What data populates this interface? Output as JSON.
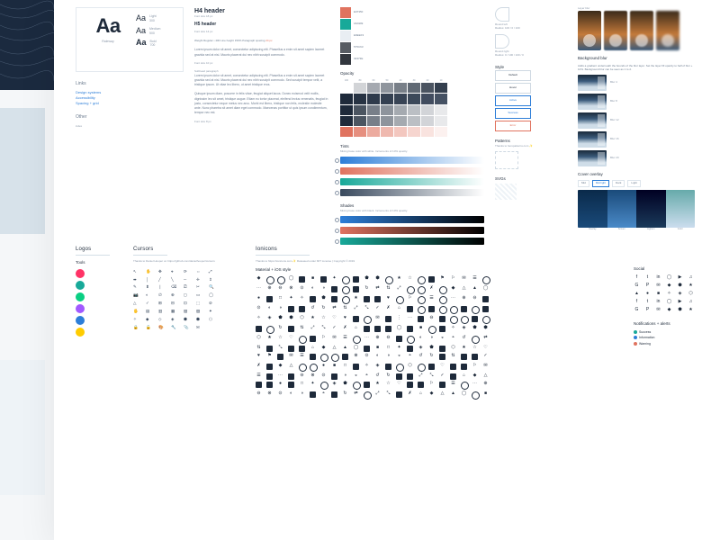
{
  "font": {
    "family": "Raleway",
    "sample": "Aa",
    "weights": [
      {
        "name": "Light",
        "w": "300"
      },
      {
        "name": "Medium",
        "w": "500"
      },
      {
        "name": "Bold",
        "w": "700"
      }
    ]
  },
  "links_header": "Links",
  "links": [
    "Design systems",
    "Accessibility",
    "Spacing + grid"
  ],
  "other_header": "Other",
  "other_links": [
    "index"
  ],
  "h4": "H4 header",
  "h4_meta": "Font size 18 px",
  "h5": "H5 header",
  "h5_meta": "Font size 14 px",
  "para_meta_prefix": "Weight Regular • 400    Line height 150%    Paragraph spacing ",
  "para_meta_em": "24 px",
  "p1": "Lorem ipsum dolor sit amet, consectetur adipiscing elit. Phasellus a enim sit amet sapien laoreet gravida sed at nisi. Mauris placerat dui nec nibh suscipit commodo.",
  "para_footer": "Font size 10 px",
  "subhead_para": "Subhead paragraph",
  "p2": "Lorem ipsum dolor sit amet, consectetur adipiscing elit. Phasellus a enim sit amet sapien laoreet gravida sed at nisi. Mauris placerat dui nec nibh suscipit commodo. Sed suscipit tempor velit, a tristique ipsum. Ut vitae leo libero, ut amet tristique eros.",
  "p3": "Quisque ipsum diam, posuere in felis vitae, feugiat aliquet lacus. Donec euismod velit mollis, dignissim leo sit amet, tristique augue. Etiam eu tortor placerat, eleifend lectus venenatis, feugiat in justo, consectetur neque metus nec arcu. Morbi est libero, tristique non felis, molestie molestie ante. Nunc pharetra sit amet diam eget commodo. Maecenas porttitor ut quis ipsum condimentum, tempor nec est.",
  "para2_footer": "Font size 8 px",
  "palette": [
    {
      "hex": "#E0735F",
      "label": "E0735F"
    },
    {
      "hex": "#18A999",
      "label": "18A999"
    },
    {
      "hex": "#E9EEF3",
      "label": "E9EEF3"
    },
    {
      "hex": "#575C63",
      "label": "575C63"
    },
    {
      "hex": "#32373E",
      "label": "32373E"
    }
  ],
  "opacity_header": "Opacity",
  "opacity_steps": [
    "100",
    "80",
    "60",
    "50",
    "40",
    "30",
    "20",
    "10"
  ],
  "opacity_cols": [
    "#FFFFFF",
    "#1E2A3A",
    "#1E2A3A",
    "#1E2A3A",
    "#E0735F"
  ],
  "bg_for_op": [
    "#1E2A3A",
    "#4a5668",
    "#FFFFFF",
    "#FFFFFF",
    "#FFFFFF"
  ],
  "tints_header": "Tints",
  "tints_note": "Mixing base color with white. Increments of 10% opacity.",
  "tint_colors": [
    "#2d7ed8",
    "#e0735f",
    "#18a999",
    "#3a4a5e"
  ],
  "shades_header": "Shades",
  "shades_note": "Mixing base color with black. Increments of 10% opacity.",
  "shade_colors": [
    "#2d7ed8",
    "#e0735f",
    "#18a999"
  ],
  "borders": {
    "round_left": {
      "label": "Round left",
      "radius": "Radius: 100 / 0 / 100"
    },
    "round_right": {
      "label": "Round right",
      "radius": "Radius: 0 / 100 / 100 / 0"
    }
  },
  "style_header": "Style",
  "styles": [
    {
      "name": "Default",
      "cls": ""
    },
    {
      "name": "Hover",
      "cls": ""
    },
    {
      "name": "Active",
      "cls": "active"
    },
    {
      "name": "Success",
      "cls": "active"
    },
    {
      "name": "Error",
      "cls": "error"
    }
  ],
  "patterns_header": "Patterns",
  "patterns_note": "Thanks to heropatterns.com ✨",
  "svgs_header": "SVGs",
  "layerblur_header": "Layer blur",
  "bgblur_header": "Background blur",
  "bgblur_note": "Adds a gradient underneath the bounds of the blur layer. Set the layer fill opacity to half of blur + 10%. Background blur can be seen as 1 to 2.",
  "bgblur_levels": [
    "Blur 4",
    "Blur 8",
    "Blur 12",
    "Blur 16",
    "Blur 20"
  ],
  "cover_header": "Cover overlay",
  "cover_tabs": [
    "Mid",
    "Mid light",
    "Dark",
    "Light"
  ],
  "cover_labels": [
    "Overlay",
    "Screen",
    "Lighten",
    "Color"
  ],
  "logos_header": "Logos",
  "tools_header": "Tools",
  "tool_colors": [
    "#ff3366",
    "#18a999",
    "#0acf83",
    "#a259ff",
    "#2d7ed8",
    "#ffcc00"
  ],
  "cursors_header": "Cursors",
  "cursors_note": "Thanks to Daniel Hooper on https://github.com/danielhooper/cursors",
  "cursors": [
    "↖",
    "✋",
    "✥",
    "⌖",
    "⟳",
    "⇔",
    "⤢",
    "⬌",
    "│",
    "╱",
    "╲",
    "─",
    "✛",
    "⇕",
    "✎",
    "⬍",
    "❘",
    "⌫",
    "⎚",
    "✂",
    "🔍",
    "📷",
    "◐",
    "∅",
    "⊕",
    "◻",
    "▭",
    "◯",
    "△",
    "✓",
    "⊞",
    "⊟",
    "⊡",
    "⬚",
    "⊘",
    "🖐",
    "▤",
    "▥",
    "▦",
    "▧",
    "▨",
    "✦",
    "✧",
    "◆",
    "◇",
    "◈",
    "⬟",
    "⬢",
    "⬡",
    "🔒",
    "🔓",
    "🎨",
    "🔧",
    "📎",
    "✉"
  ],
  "ionicons_header": "Ionicons",
  "ionicons_note": "Thanks to https://ionicons.com ✨ Released under MIT License | Copyright © 2019",
  "material_header": "Material + iOS style",
  "social_header": "Social",
  "notif_header": "Notifications + alerts",
  "notif": [
    {
      "label": "Success",
      "color": "#18a999"
    },
    {
      "label": "Information",
      "color": "#2d7ed8"
    },
    {
      "label": "Warning",
      "color": "#e0735f"
    }
  ]
}
